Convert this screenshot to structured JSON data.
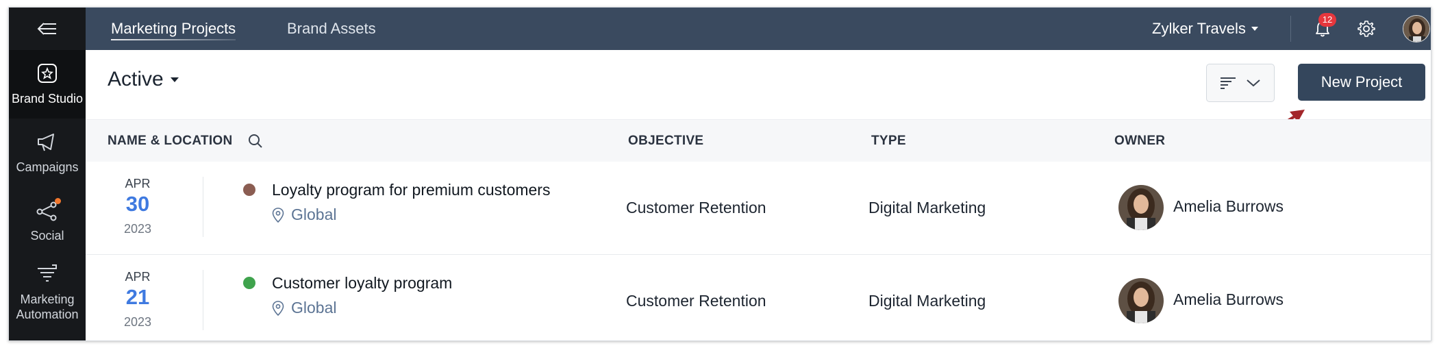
{
  "sidebar": {
    "back_icon": "collapse-arrow-icon",
    "items": [
      {
        "label": "Brand Studio",
        "icon": "brand-studio-icon",
        "active": true
      },
      {
        "label": "Campaigns",
        "icon": "megaphone-icon",
        "active": false
      },
      {
        "label": "Social",
        "icon": "social-share-icon",
        "active": false,
        "has_dot": true
      },
      {
        "label": "Marketing\nAutomation",
        "label_line1": "Marketing",
        "label_line2": "Automation",
        "icon": "funnel-icon",
        "active": false
      }
    ]
  },
  "topbar": {
    "tabs": [
      {
        "label": "Marketing Projects",
        "active": true
      },
      {
        "label": "Brand Assets",
        "active": false
      }
    ],
    "org_name": "Zylker Travels",
    "notification_count": "12",
    "icons": [
      "bell-icon",
      "gear-icon",
      "user-avatar"
    ]
  },
  "toolbar": {
    "status_filter": "Active",
    "sort_icon": "sort-lines-icon",
    "new_project_label": "New Project"
  },
  "table": {
    "columns": [
      "NAME & LOCATION",
      "OBJECTIVE",
      "TYPE",
      "OWNER"
    ],
    "rows": [
      {
        "month": "APR",
        "day": "30",
        "year": "2023",
        "status_color": "#8b5d52",
        "name": "Loyalty program for premium customers",
        "location": "Global",
        "objective": "Customer Retention",
        "type": "Digital Marketing",
        "owner": "Amelia Burrows"
      },
      {
        "month": "APR",
        "day": "21",
        "year": "2023",
        "status_color": "#3fa34d",
        "name": "Customer loyalty program",
        "location": "Global",
        "objective": "Customer Retention",
        "type": "Digital Marketing",
        "owner": "Amelia Burrows"
      }
    ]
  },
  "colors": {
    "sidebar_bg": "#17191c",
    "topbar_bg": "#3a4a5f",
    "primary_button": "#34465c",
    "date_accent": "#3f7ae0",
    "badge": "#e6373d",
    "annotation_arrow": "#a3262a"
  }
}
